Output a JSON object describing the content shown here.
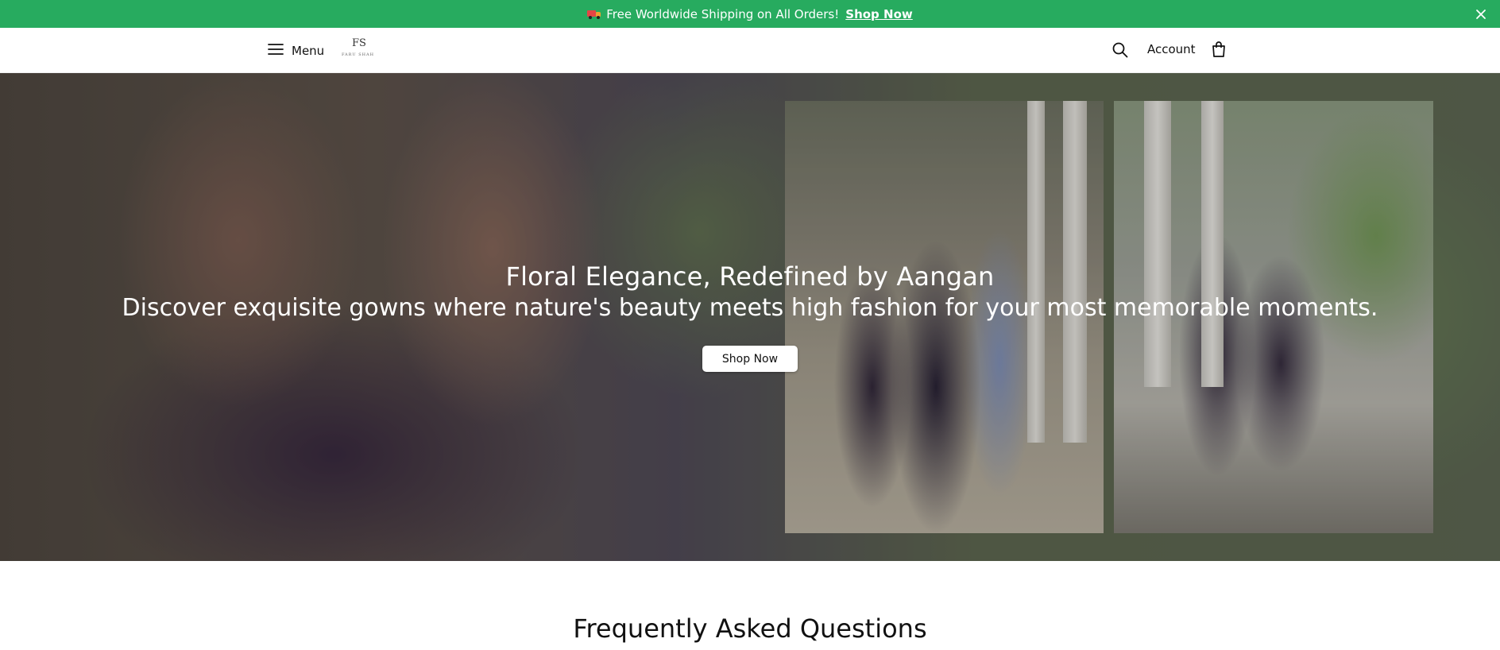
{
  "announcement": {
    "text": "Free Worldwide Shipping on All Orders!",
    "link_label": "Shop Now",
    "truck_icon": "delivery-truck-icon",
    "close_icon": "close-icon",
    "background": "#27ab5f"
  },
  "header": {
    "menu_label": "Menu",
    "menu_icon": "hamburger-icon",
    "logo_monogram": "FS",
    "logo_text": "FARU SHAH",
    "search_icon": "search-icon",
    "account_label": "Account",
    "cart_icon": "shopping-bag-icon"
  },
  "hero": {
    "title": "Floral Elegance, Redefined by Aangan",
    "subtitle": "Discover exquisite gowns where nature's beauty meets high fashion for your most memorable moments.",
    "button_label": "Shop Now"
  },
  "faq": {
    "title": "Frequently Asked Questions"
  }
}
